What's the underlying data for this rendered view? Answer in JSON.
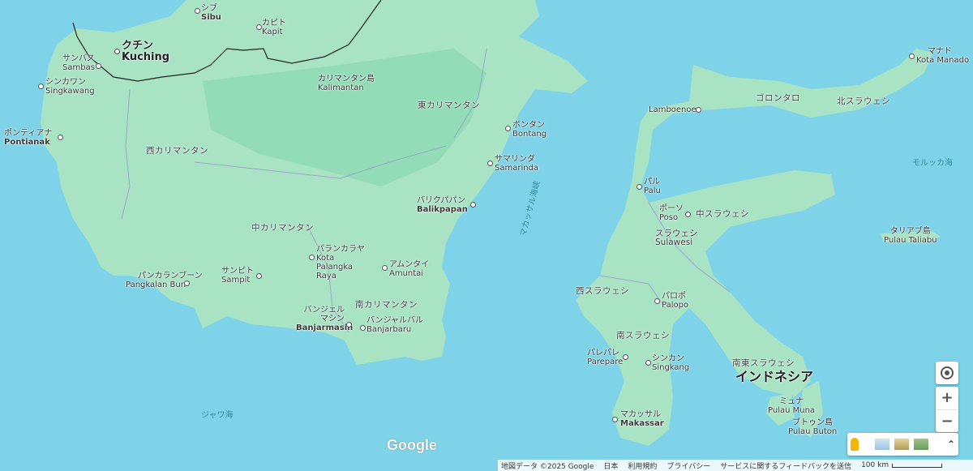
{
  "map": {
    "colors": {
      "sea": "#7fd3e8",
      "land": "#a8e4c4",
      "land_dark": "#8fd8b4",
      "border": "#222222"
    },
    "cities": [
      {
        "id": "sibu",
        "jp": "シブ",
        "en": "Sibu"
      },
      {
        "id": "kapit",
        "jp": "カピト",
        "en": "Kapit"
      },
      {
        "id": "kuching",
        "jp": "クチン",
        "en": "Kuching"
      },
      {
        "id": "sambas",
        "jp": "サンバス",
        "en": "Sambas"
      },
      {
        "id": "singkawang",
        "jp": "シンカワン",
        "en": "Singkawang"
      },
      {
        "id": "pontianak",
        "jp": "ポンティアナ",
        "en": "Pontianak"
      },
      {
        "id": "bontang",
        "jp": "ボンタン",
        "en": "Bontang"
      },
      {
        "id": "samarinda",
        "jp": "サマリンダ",
        "en": "Samarinda"
      },
      {
        "id": "balikpapan",
        "jp": "バリクパパン",
        "en": "Balikpapan"
      },
      {
        "id": "palangka",
        "jp": "パランカラヤ",
        "en": "Kota Palangka Raya"
      },
      {
        "id": "amuntai",
        "jp": "アムンタイ",
        "en": "Amuntai"
      },
      {
        "id": "sampit",
        "jp": "サンピト",
        "en": "Sampit"
      },
      {
        "id": "pangkalan",
        "jp": "パンカランブーン",
        "en": "Pangkalan Bun"
      },
      {
        "id": "banjarmasin",
        "jp": "バンジェルマシン",
        "en": "Banjarmasin"
      },
      {
        "id": "banjarbaru",
        "jp": "バンジャルバル",
        "en": "Banjarbaru"
      },
      {
        "id": "manado",
        "jp": "マナド",
        "en": "Kota Manado"
      },
      {
        "id": "lamboenoe",
        "jp": "",
        "en": "Lamboenoe"
      },
      {
        "id": "palu",
        "jp": "パル",
        "en": "Palu"
      },
      {
        "id": "poso",
        "jp": "ポーソ",
        "en": "Poso"
      },
      {
        "id": "palopo",
        "jp": "パロポ",
        "en": "Palopo"
      },
      {
        "id": "parepare",
        "jp": "パレパレ",
        "en": "Parepare"
      },
      {
        "id": "singkang",
        "jp": "シンカン",
        "en": "Singkang"
      },
      {
        "id": "makassar",
        "jp": "マカッサル",
        "en": "Makassar"
      },
      {
        "id": "muna",
        "jp": "ミュナ",
        "en": "Pulau Muna"
      },
      {
        "id": "buton",
        "jp": "ブトゥン島",
        "en": "Pulau Buton"
      },
      {
        "id": "taliabu",
        "jp": "タリアブ島",
        "en": "Pulau Taliabu"
      }
    ],
    "regions": {
      "kalimantan_jp": "カリマンタン島",
      "kalimantan_en": "Kalimantan",
      "east_kalimantan": "東カリマンタン",
      "west_kalimantan": "西カリマンタン",
      "central_kalimantan": "中カリマンタン",
      "south_kalimantan": "南カリマンタン",
      "gorontalo": "ゴロンタロ",
      "north_sulawesi": "北スラウェシ",
      "central_sulawesi": "中スラウェシ",
      "sulawesi_jp": "スラウェシ",
      "sulawesi_en": "Sulawesi",
      "west_sulawesi": "西スラウェシ",
      "south_sulawesi": "南スラウェシ",
      "southeast_sulawesi": "南東スラウェシ",
      "indonesia": "インドネシア"
    },
    "seas": {
      "java_sea": "ジャワ海",
      "molucca_sea": "モルッカ海",
      "makassar_strait": "マカッサル海峡"
    }
  },
  "controls": {
    "locate_icon": "my-location-icon",
    "zoom_in": "+",
    "zoom_out": "−",
    "pegman_icon": "pegman-icon",
    "expand_icon": "double-chevron-up-icon"
  },
  "logo": "Google",
  "footer": {
    "map_data": "地図データ ©2025 Google",
    "country": "日本",
    "terms": "利用規約",
    "privacy": "プライバシー",
    "feedback": "サービスに関するフィードバックを送信",
    "scale": "100 km"
  }
}
